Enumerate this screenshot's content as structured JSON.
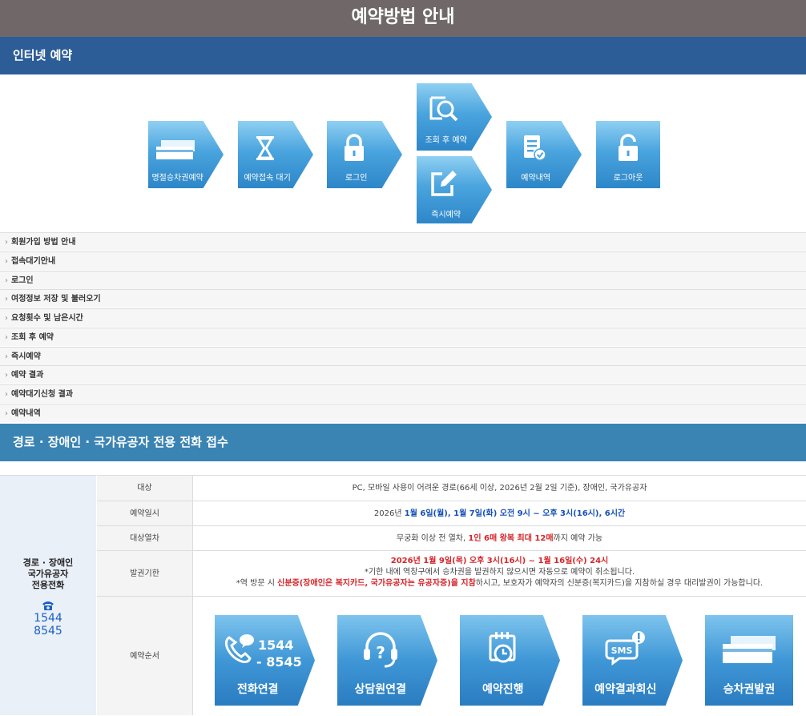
{
  "page_title": "예약방법 안내",
  "section1_title": "인터넷 예약",
  "internet_steps": [
    {
      "label": "명절승차권예약",
      "icon": "ticket-icon"
    },
    {
      "label": "예약접속 대기",
      "icon": "hourglass-icon"
    },
    {
      "label": "로그인",
      "icon": "lock-icon"
    },
    {
      "label": "조회 후 예약",
      "icon": "search-document-icon"
    },
    {
      "label": "즉시예약",
      "icon": "edit-icon"
    },
    {
      "label": "예약내역",
      "icon": "document-check-icon"
    },
    {
      "label": "로그아웃",
      "icon": "unlock-icon"
    }
  ],
  "accordion": [
    "회원가입 방법 안내",
    "접속대기안내",
    "로그인",
    "여정정보 저장 및 불러오기",
    "요청횟수 및 남은시간",
    "조회 후 예약",
    "즉시예약",
    "예약 결과",
    "예약대기신청 결과",
    "예약내역"
  ],
  "section2_title": "경로 · 장애인 · 국가유공자 전용 전화 접수",
  "phone": {
    "title_line1": "경로 · 장애인",
    "title_line2": "국가유공자",
    "title_line3": "전용전화",
    "icon": "telephone-icon",
    "number_line1": "1544",
    "number_line2": "8545"
  },
  "rows": {
    "target_label": "대상",
    "target_value": "PC, 모바일 사용이 어려운 경로(66세 이상, 2026년 2월 2일 기준), 장애인, 국가유공자",
    "date_label": "예약일시",
    "date_pre": "2026년 ",
    "date_d1": "1월 6일(월)",
    "date_sep": ", ",
    "date_d2": "1월 7일(화) 오전 9시 ~ 오후 3시(16시)",
    "date_mid": ", ",
    "date_d3": "6시간",
    "train_label": "대상열차",
    "train_pre": "무궁화 이상 전 열차, ",
    "train_red": "1인 6매 왕복 최대 12매",
    "train_post": "까지 예약 가능",
    "issue_label": "발권기한",
    "issue_red": "2026년 1월 9일(목) 오후 3시(16시) ~ 1월 16일(수) 24시",
    "issue_note1": "*기한 내에 역창구에서 승차권을 발권하지 않으시면 자동으로 예약이 취소됩니다.",
    "issue_note2_pre": "*역 방문 시 ",
    "issue_note2_red1": "신분증(장애인은 복지카드, 국가유공자는 유공자증)을 지참",
    "issue_note2_post": "하시고, 보호자가 예약자의 신분증(복지카드)을 지참하실 경우 대리발권이 가능합니다.",
    "order_label": "예약순서"
  },
  "phone_steps": [
    {
      "label": "전화연결",
      "icon": "phone-call-icon",
      "number_a": "1544",
      "number_b": "- 8545"
    },
    {
      "label": "상담원연결",
      "icon": "headset-icon"
    },
    {
      "label": "예약진행",
      "icon": "calendar-clock-icon"
    },
    {
      "label": "예약결과회신",
      "icon": "sms-icon",
      "sms_text": "SMS"
    },
    {
      "label": "승차권발권",
      "icon": "ticket-icon"
    }
  ]
}
